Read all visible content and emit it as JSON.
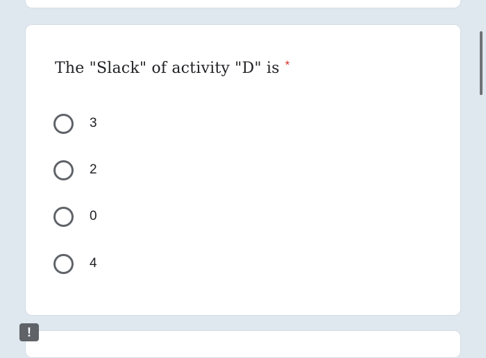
{
  "question": {
    "text": "The \"Slack\" of activity \"D\" is",
    "required_mark": "*"
  },
  "options": [
    {
      "label": "3"
    },
    {
      "label": "2"
    },
    {
      "label": "0"
    },
    {
      "label": "4"
    }
  ],
  "alert": {
    "icon": "exclamation-icon",
    "symbol": "!"
  },
  "colors": {
    "background": "#dfe7ef",
    "card": "#ffffff",
    "required": "#d93025",
    "radio_border": "#5f6368"
  }
}
